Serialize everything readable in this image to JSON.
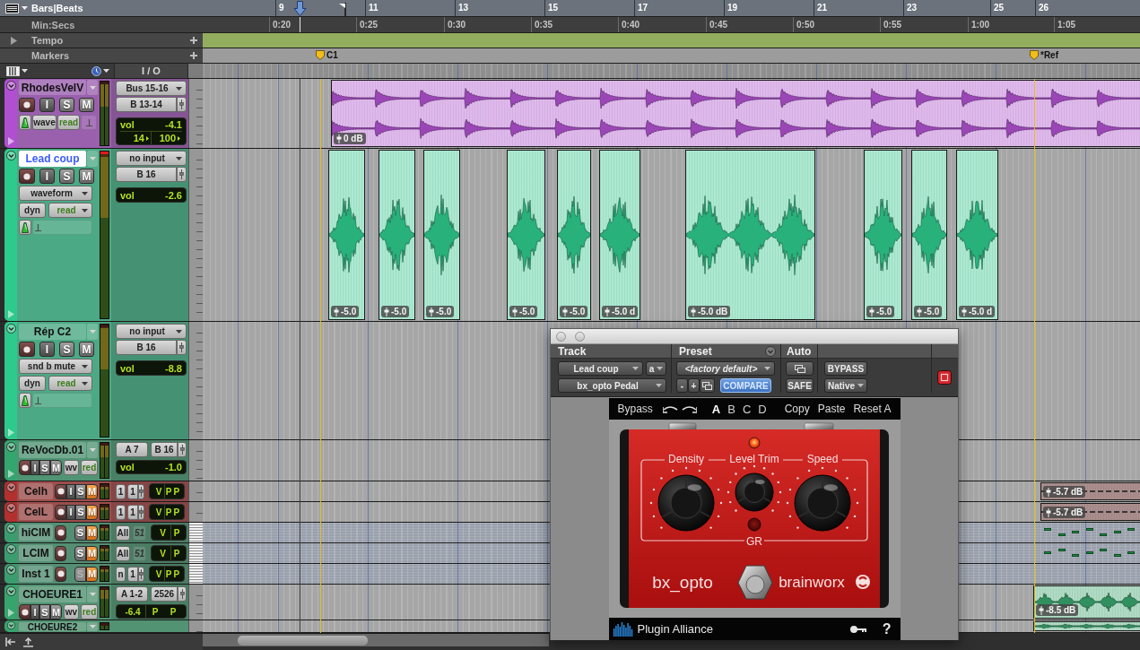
{
  "rulers": [
    {
      "kind": "bars",
      "label": "Bars|Beats",
      "ticks": [
        "9",
        "11",
        "13",
        "15",
        "17",
        "19",
        "21",
        "23",
        "25",
        "26"
      ]
    },
    {
      "kind": "time",
      "label": "Min:Secs",
      "ticks": [
        "0:20",
        "0:25",
        "0:30",
        "0:35",
        "0:40",
        "0:45",
        "0:50",
        "0:55",
        "1:00",
        "1:05"
      ]
    },
    {
      "kind": "tempo",
      "label": "Tempo"
    },
    {
      "kind": "markers",
      "label": "Markers",
      "markers": [
        "C1",
        "*Ref"
      ]
    }
  ],
  "column_header": {
    "io": "I / O"
  },
  "tracks": [
    {
      "name": "RhodesVelV",
      "kind": "medium",
      "color": "#b04fd0",
      "selected": false,
      "muted": false,
      "solo_disabled": false,
      "clipped": false,
      "buttons": [
        {
          "kind": "input",
          "label": "I"
        },
        {
          "kind": "solo",
          "label": "S"
        },
        {
          "kind": "mute",
          "label": "M"
        }
      ],
      "view": "wave",
      "automation": "read",
      "input": "Bus 15-16",
      "output": "B 13-14",
      "readout": [
        {
          "kind": "volume",
          "label": "vol",
          "value": "-4.1"
        },
        {
          "kind": "pan",
          "values": [
            "14",
            "100"
          ]
        }
      ],
      "clips": [
        {
          "kind": "audio",
          "gain": "0 dB"
        }
      ]
    },
    {
      "name": "Lead coup",
      "kind": "large",
      "color": "#2ec98c",
      "selected": true,
      "muted": false,
      "solo_disabled": false,
      "clipped": true,
      "buttons": [
        {
          "kind": "input",
          "label": "I"
        },
        {
          "kind": "solo",
          "label": "S"
        },
        {
          "kind": "mute",
          "label": "M"
        }
      ],
      "view": "waveform",
      "dyn": "dyn",
      "automation": "read",
      "input": "no input",
      "output": "B 16",
      "readout": [
        {
          "kind": "volume",
          "label": "vol",
          "value": "-2.6"
        }
      ],
      "clips": [
        {
          "kind": "audio",
          "gain": "-5.0"
        },
        {
          "kind": "audio",
          "gain": "-5.0"
        },
        {
          "kind": "audio",
          "gain": "-5.0"
        },
        {
          "kind": "audio",
          "gain": "-5.0"
        },
        {
          "kind": "audio",
          "gain": "-5.0"
        },
        {
          "kind": "audio",
          "gain": "-5.0 d"
        },
        {
          "kind": "audio",
          "gain": "-5.0 dB"
        },
        {
          "kind": "audio",
          "gain": "-5.0"
        },
        {
          "kind": "audio",
          "gain": "-5.0"
        },
        {
          "kind": "audio",
          "gain": "-5.0 d"
        }
      ]
    },
    {
      "name": "Rép C2",
      "kind": "large",
      "color": "#2ec98c",
      "selected": false,
      "muted": false,
      "solo_disabled": false,
      "clipped": false,
      "buttons": [
        {
          "kind": "input",
          "label": "I"
        },
        {
          "kind": "solo",
          "label": "S"
        },
        {
          "kind": "mute",
          "label": "M"
        }
      ],
      "view": "snd b mute",
      "dyn": "dyn",
      "automation": "read",
      "input": "no input",
      "output": "B 16",
      "readout": [
        {
          "kind": "volume",
          "label": "vol",
          "value": "-8.8"
        }
      ]
    },
    {
      "name": "ReVocDb.01",
      "kind": "compact",
      "color": "#34a56f",
      "selected": false,
      "muted": false,
      "solo_disabled": false,
      "clipped": false,
      "buttons": [
        {
          "kind": "input",
          "label": "I"
        },
        {
          "kind": "solo",
          "label": "S"
        },
        {
          "kind": "mute",
          "label": "M"
        }
      ],
      "view": "wv",
      "automation": "red",
      "input": "A 7",
      "output": "B 16",
      "readout": [
        {
          "kind": "volume",
          "label": "vol",
          "value": "-1.0"
        }
      ]
    },
    {
      "name": "Celh",
      "kind": "mini",
      "color": "#b3302f",
      "selected": false,
      "muted": true,
      "solo_disabled": false,
      "clipped": false,
      "buttons": [
        {
          "kind": "input",
          "label": "I"
        },
        {
          "kind": "solo",
          "label": "S"
        },
        {
          "kind": "mute",
          "label": "M"
        }
      ],
      "input": "1",
      "output": "1",
      "readout": [
        {
          "kind": "flags",
          "values": [
            "V",
            "P",
            "P"
          ]
        }
      ],
      "clips": [
        {
          "kind": "quiet",
          "gain": "-5.7 dB"
        }
      ]
    },
    {
      "name": "CelL",
      "kind": "mini",
      "color": "#b3302f",
      "selected": false,
      "muted": true,
      "solo_disabled": false,
      "clipped": false,
      "buttons": [
        {
          "kind": "input",
          "label": "I"
        },
        {
          "kind": "solo",
          "label": "S"
        },
        {
          "kind": "mute",
          "label": "M"
        }
      ],
      "input": "1",
      "output": "1",
      "readout": [
        {
          "kind": "flags",
          "values": [
            "V",
            "P",
            "P"
          ]
        }
      ],
      "clips": [
        {
          "kind": "quiet",
          "gain": "-5.7 dB"
        }
      ]
    },
    {
      "name": "hiCIM",
      "kind": "midi",
      "color": "#3a9d6e",
      "selected": false,
      "muted": true,
      "solo_disabled": false,
      "clipped": false,
      "buttons": [
        {
          "kind": "solo",
          "label": "S"
        },
        {
          "kind": "mute",
          "label": "M"
        }
      ],
      "input": "All",
      "output": "51",
      "readout": [
        {
          "kind": "flags",
          "values": [
            "V",
            "P"
          ]
        }
      ],
      "clips": [
        {
          "kind": "midi"
        }
      ]
    },
    {
      "name": "LCIM",
      "kind": "midi",
      "color": "#3a9d6e",
      "selected": false,
      "muted": true,
      "solo_disabled": false,
      "clipped": false,
      "buttons": [
        {
          "kind": "solo",
          "label": "S"
        },
        {
          "kind": "mute",
          "label": "M"
        }
      ],
      "input": "All",
      "output": "51",
      "readout": [
        {
          "kind": "flags",
          "values": [
            "V",
            "P"
          ]
        }
      ],
      "clips": [
        {
          "kind": "midi"
        }
      ]
    },
    {
      "name": "Inst 1",
      "kind": "instrument",
      "color": "#3a9d6e",
      "selected": false,
      "muted": true,
      "solo_disabled": true,
      "clipped": false,
      "buttons": [
        {
          "kind": "solo",
          "label": "S"
        },
        {
          "kind": "mute",
          "label": "M"
        }
      ],
      "input": "n",
      "output": "1",
      "readout": [
        {
          "kind": "flags",
          "values": [
            "V",
            "P",
            "P"
          ]
        }
      ]
    },
    {
      "name": "CHOEURE1",
      "kind": "compact",
      "color": "#36a46c",
      "selected": false,
      "muted": false,
      "solo_disabled": false,
      "clipped": false,
      "buttons": [
        {
          "kind": "input",
          "label": "I"
        },
        {
          "kind": "solo",
          "label": "S"
        },
        {
          "kind": "mute",
          "label": "M"
        }
      ],
      "view": "wv",
      "automation": "red",
      "input": "A 1-2",
      "output": "2526",
      "readout": [
        {
          "kind": "flags",
          "values": [
            "-6.4",
            "P",
            "P"
          ]
        }
      ],
      "clips": [
        {
          "kind": "audio",
          "gain": "-8.5 dB"
        }
      ]
    },
    {
      "name": "CHOEURE2",
      "kind": "compact",
      "color": "#36a46c",
      "selected": false,
      "clipped": false,
      "clips": [
        {
          "kind": "audio"
        }
      ]
    }
  ],
  "plugin": {
    "columns": [
      "Track",
      "Preset",
      "Auto"
    ],
    "track": "Lead coup",
    "slot": "a",
    "insert": "bx_opto Pedal",
    "preset": "<factory default>",
    "preset_steps": [
      "-",
      "+"
    ],
    "compare": {
      "label": "COMPARE",
      "on": true
    },
    "safe": {
      "label": "SAFE",
      "on": false
    },
    "bypass": {
      "label": "BYPASS",
      "on": false
    },
    "mode": "Native",
    "target_on": true,
    "toolbar": {
      "bypass": "Bypass",
      "slots": [
        {
          "label": "A",
          "selected": true
        },
        {
          "label": "B",
          "selected": false
        },
        {
          "label": "C",
          "selected": false
        },
        {
          "label": "D",
          "selected": false
        }
      ],
      "actions": [
        "Copy",
        "Paste",
        "Reset A"
      ]
    },
    "pedal": {
      "power_led": true,
      "gr_led": false,
      "knobs": [
        {
          "label": "Density"
        },
        {
          "label": "Level Trim"
        },
        {
          "label": "Speed"
        }
      ],
      "meter_label": "GR",
      "model": "bx_opto",
      "brand": "brainworx"
    },
    "footer": {
      "brand": "Plugin Alliance",
      "help": "?"
    }
  }
}
